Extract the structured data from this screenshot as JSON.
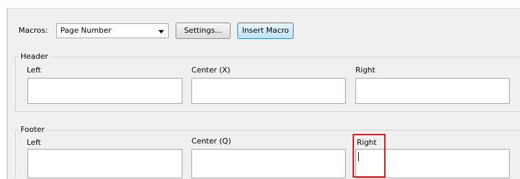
{
  "macros": {
    "label": "Macros:",
    "selected": "Page Number",
    "settings_label": "Settings...",
    "insert_label": "Insert Macro"
  },
  "header": {
    "title": "Header",
    "left_label": "Left",
    "center_label": "Center (X)",
    "right_label": "Right",
    "left_value": "",
    "center_value": "",
    "right_value": ""
  },
  "footer": {
    "title": "Footer",
    "left_label": "Left",
    "center_label": "Center (Q)",
    "right_label": "Right",
    "left_value": "",
    "center_value": "",
    "right_value": ""
  },
  "colors": {
    "panel_bg": "#f0f0f0",
    "highlight": "#e0141c",
    "insert_button_bg": "#bfe3f7"
  }
}
